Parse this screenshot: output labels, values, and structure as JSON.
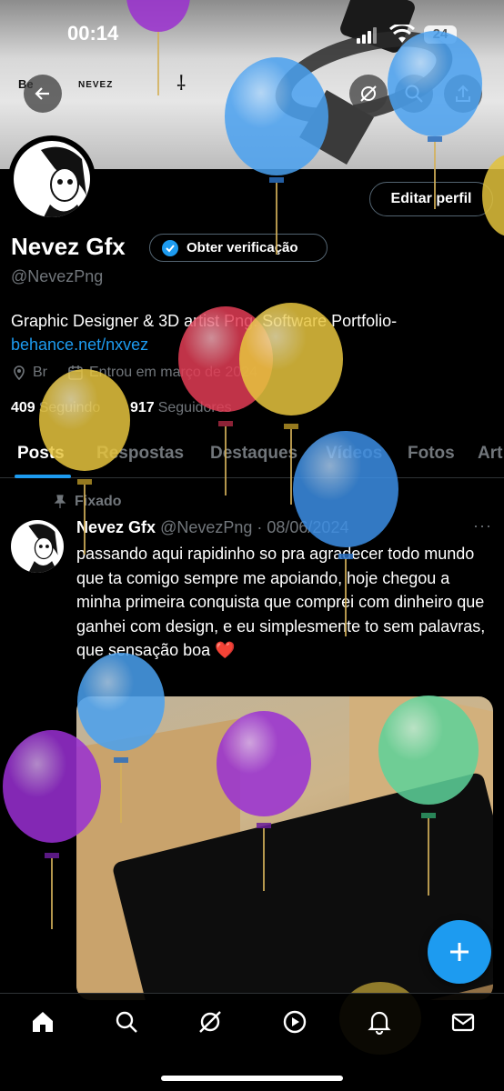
{
  "status_bar": {
    "time": "00:14",
    "battery": "24"
  },
  "banner": {
    "left_text": "Be",
    "logo_text": "NEVEZ",
    "glyph": "⸸"
  },
  "profile": {
    "display_name": "Nevez Gfx",
    "verify_label": "Obter verificação",
    "handle": "@NevezPng",
    "bio": "Graphic Designer & 3D artist Png. Software Portfolio-",
    "link": "behance.net/nxvez",
    "location": "Br",
    "joined": "Entrou em março de 2024",
    "following_count": "409",
    "following_label": "Seguindo",
    "followers_count": "917",
    "followers_label": "Seguidores",
    "edit_label": "Editar perfil"
  },
  "tabs": [
    {
      "label": "Posts"
    },
    {
      "label": "Respostas"
    },
    {
      "label": "Destaques"
    },
    {
      "label": "Vídeos"
    },
    {
      "label": "Fotos"
    },
    {
      "label": "Art"
    }
  ],
  "post": {
    "pinned_label": "Fixado",
    "author": "Nevez Gfx",
    "handle_date": "@NevezPng · 08/06/2024",
    "text": "passando aqui rapidinho so pra agradecer todo mundo que ta comigo sempre me apoiando, hoje chegou a minha primeira conquista que comprei com dinheiro que ganhei com design, e eu simplesmente to sem palavras, que sensação boa ❤️"
  },
  "colors": {
    "accent": "#1d9bf0",
    "background": "#000000",
    "muted": "#71767b"
  },
  "nav_icons": [
    "home-icon",
    "search-icon",
    "grok-icon",
    "video-icon",
    "notifications-icon",
    "messages-icon"
  ]
}
